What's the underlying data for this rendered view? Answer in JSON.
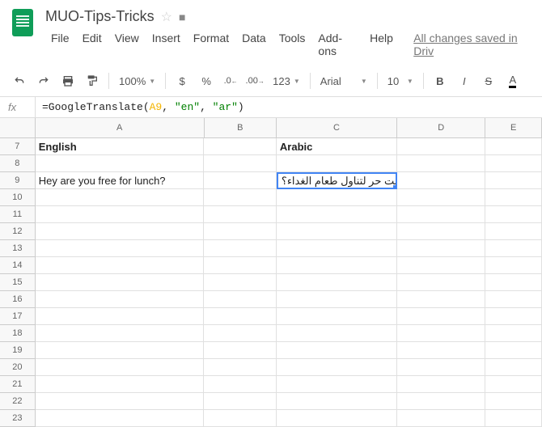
{
  "header": {
    "doc_title": "MUO-Tips-Tricks",
    "save_status": "All changes saved in Driv"
  },
  "menubar": {
    "file": "File",
    "edit": "Edit",
    "view": "View",
    "insert": "Insert",
    "format": "Format",
    "data": "Data",
    "tools": "Tools",
    "addons": "Add-ons",
    "help": "Help"
  },
  "toolbar": {
    "zoom": "100%",
    "dollar": "$",
    "percent": "%",
    "dec_dec": ".0",
    "inc_dec": ".00",
    "numfmt": "123",
    "font": "Arial",
    "font_size": "10",
    "bold": "B",
    "italic": "I",
    "strike": "S",
    "color": "A"
  },
  "formula_bar": {
    "fx": "fx",
    "prefix": "=GoogleTranslate(",
    "ref": "A9",
    "sep1": ", ",
    "str1": "\"en\"",
    "sep2": ", ",
    "str2": "\"ar\"",
    "suffix": ")"
  },
  "cols": {
    "a": "A",
    "b": "B",
    "c": "C",
    "d": "D",
    "e": "E"
  },
  "rows": {
    "7": "7",
    "8": "8",
    "9": "9",
    "10": "10",
    "11": "11",
    "12": "12",
    "13": "13",
    "14": "14",
    "15": "15",
    "16": "16",
    "17": "17",
    "18": "18",
    "19": "19",
    "20": "20",
    "21": "21",
    "22": "22",
    "23": "23"
  },
  "cells": {
    "a7": "English",
    "c7": "Arabic",
    "a9": "Hey are you free for lunch?",
    "c9": "يا أنت حر لتناول طعام الغداء؟"
  }
}
